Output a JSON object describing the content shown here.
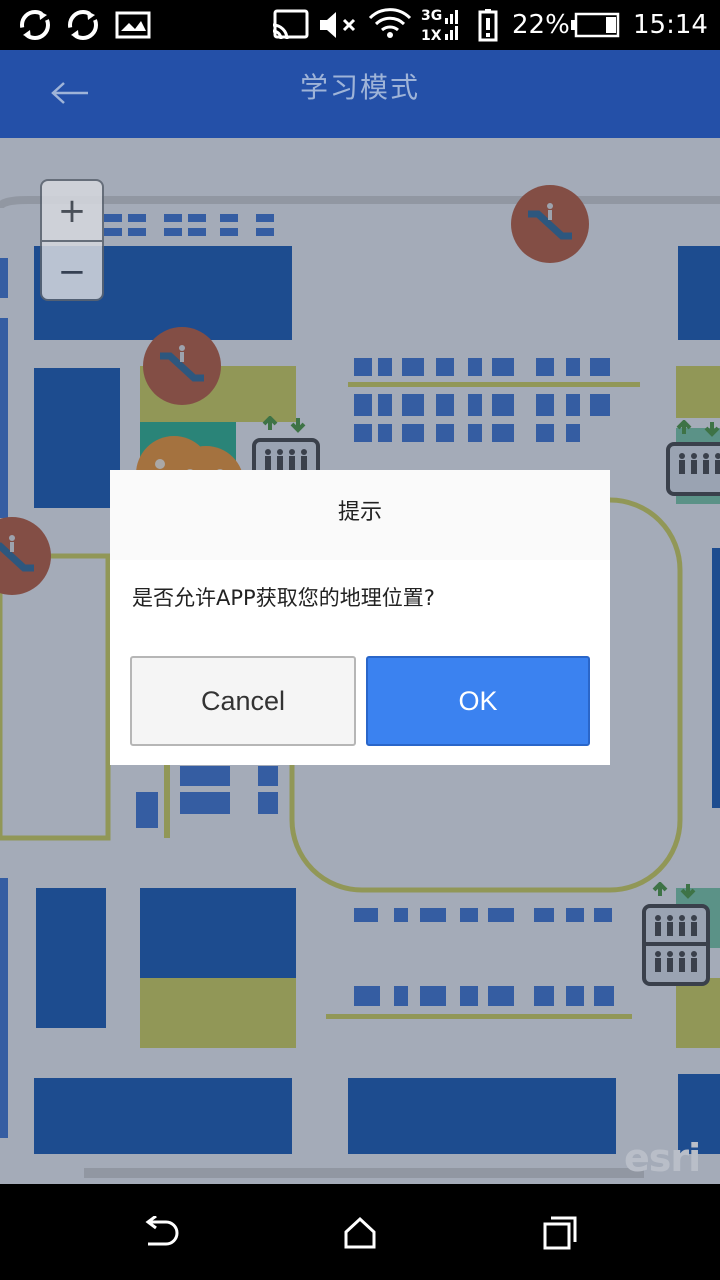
{
  "status_bar": {
    "network_3g": "3G",
    "network_1x": "1X",
    "battery_percent": "22%",
    "time": "15:14",
    "icons": [
      "sync-icon",
      "sync-icon",
      "image-icon",
      "cast-icon",
      "mute-icon",
      "wifi-icon",
      "signal-icon",
      "battery-alert-icon",
      "battery-icon"
    ]
  },
  "app_bar": {
    "title": "学习模式",
    "back_icon": "arrow-left-icon"
  },
  "map": {
    "zoom_in": "+",
    "zoom_out": "−",
    "attribution": "esri",
    "icons": [
      "escalator-icon",
      "restroom-icon",
      "elevator-icon"
    ]
  },
  "dialog": {
    "title": "提示",
    "message": "是否允许APP获取您的地理位置?",
    "cancel_label": "Cancel",
    "ok_label": "OK"
  },
  "nav_bar": {
    "icons": [
      "back-icon",
      "home-icon",
      "recents-icon"
    ]
  },
  "colors": {
    "app_bar": "#2450a8",
    "ok_button": "#3b82f0",
    "store_blue": "#0047a8",
    "store_yellow": "#c8c848",
    "escalator_marker": "#b04a28"
  }
}
